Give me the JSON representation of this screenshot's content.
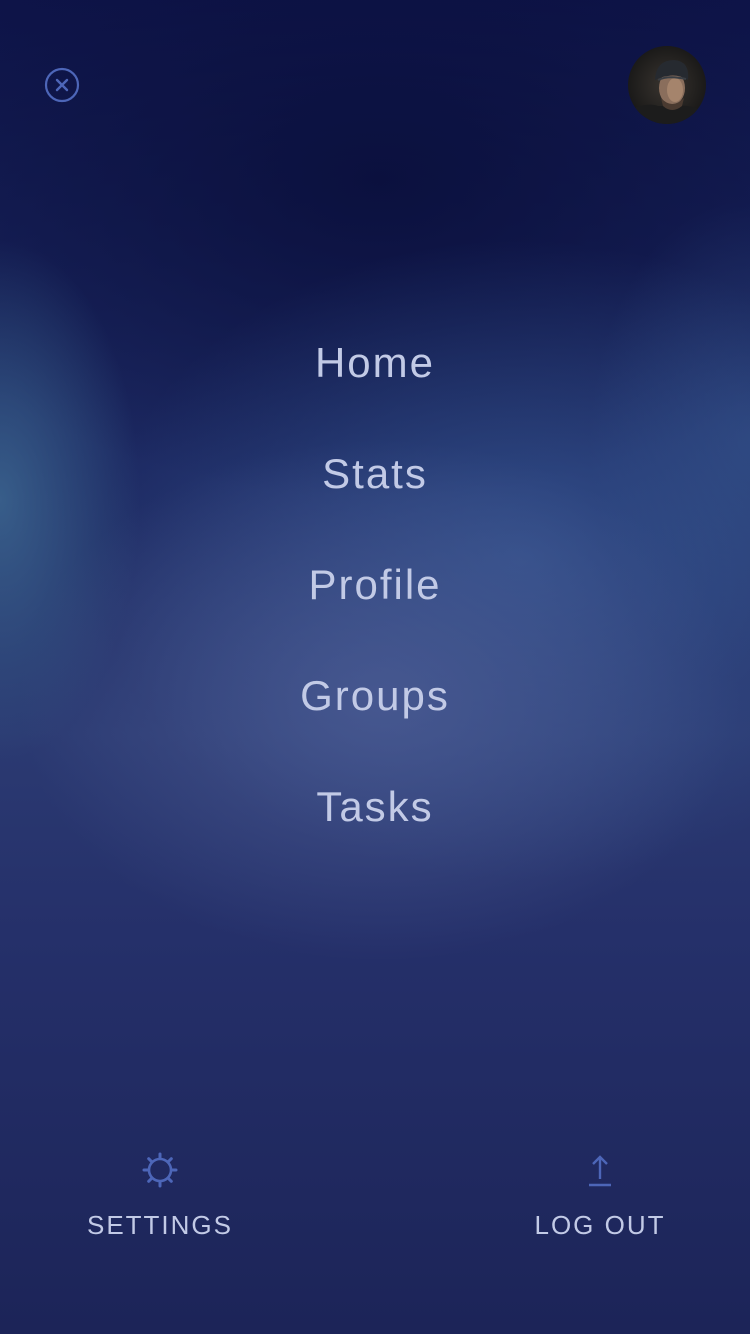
{
  "header": {
    "close_icon": "close-circle-icon",
    "avatar": "user-avatar"
  },
  "menu": {
    "items": [
      {
        "label": "Home"
      },
      {
        "label": "Stats"
      },
      {
        "label": "Profile"
      },
      {
        "label": "Groups"
      },
      {
        "label": "Tasks"
      }
    ]
  },
  "footer": {
    "settings": {
      "label": "SETTINGS",
      "icon": "gear-icon"
    },
    "logout": {
      "label": "LOG OUT",
      "icon": "upload-arrow-icon"
    }
  },
  "colors": {
    "text": "#c2cae6",
    "icon": "#4d66b8",
    "background_top": "#0e1449",
    "background_bottom": "#1c2458"
  }
}
